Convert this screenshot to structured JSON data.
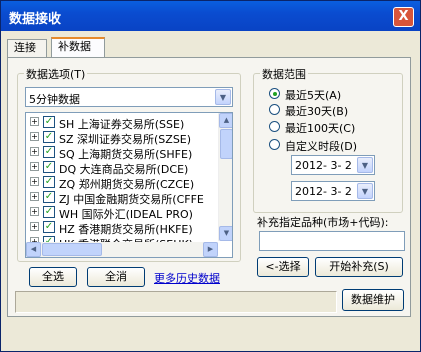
{
  "window": {
    "title": "数据接收",
    "close_glyph": "X"
  },
  "tabs": [
    {
      "label": "连接"
    },
    {
      "label": "补数据"
    }
  ],
  "data_options": {
    "group_label": "数据选项(T)",
    "period_select": "5分钟数据",
    "markets": [
      {
        "code": "SH",
        "name": "上海证券交易所(SSE)",
        "checked": true
      },
      {
        "code": "SZ",
        "name": "深圳证券交易所(SZSE)",
        "checked": true
      },
      {
        "code": "SQ",
        "name": "上海期货交易所(SHFE)",
        "checked": true
      },
      {
        "code": "DQ",
        "name": "大连商品交易所(DCE)",
        "checked": true
      },
      {
        "code": "ZQ",
        "name": "郑州期货交易所(CZCE)",
        "checked": true
      },
      {
        "code": "ZJ",
        "name": "中国金融期货交易所(CFFE",
        "checked": true
      },
      {
        "code": "WH",
        "name": "国际外汇(IDEAL PRO)",
        "checked": true
      },
      {
        "code": "HZ",
        "name": "香港期货交易所(HKFE)",
        "checked": true
      },
      {
        "code": "HK",
        "name": "香港联合交易所(SEHK)",
        "checked": true
      }
    ],
    "select_all_button": "全选",
    "deselect_all_button": "全消",
    "more_history_link": "更多历史数据"
  },
  "data_range": {
    "group_label": "数据范围",
    "options": [
      {
        "label": "最近5天(A)",
        "selected": true
      },
      {
        "label": "最近30天(B)",
        "selected": false
      },
      {
        "label": "最近100天(C)",
        "selected": false
      },
      {
        "label": "自定义时段(D)",
        "selected": false
      }
    ],
    "start_date": "2012- 3- 2",
    "end_date": "2012- 3- 2"
  },
  "supplement": {
    "label": "补充指定品种(市场+代码):",
    "input_value": "",
    "choose_button": "<-选择",
    "start_button": "开始补充(S)"
  },
  "status_text": "",
  "maintain_button": "数据维护",
  "colors": {
    "titlebar": "#0a4cd0",
    "close": "#d8553a",
    "check": "#21a121"
  }
}
